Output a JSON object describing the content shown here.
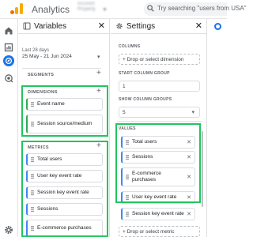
{
  "app": {
    "title": "Analytics",
    "account_line1": "Account",
    "account_line2": "Property",
    "search_placeholder": "Try searching \"users from USA\"",
    "brand_colors": {
      "accent": "#1a73e8",
      "logo_orange": "#f9ab00",
      "logo_dark": "#e37400"
    }
  },
  "rail": {
    "icons": [
      "home-icon",
      "reports-icon",
      "explore-icon",
      "advertising-icon",
      "settings-icon"
    ],
    "active": "explore-icon"
  },
  "variables": {
    "title": "Variables",
    "date": {
      "label": "Last 28 days",
      "range": "25 May - 21 Jun 2024"
    },
    "segments_label": "SEGMENTS",
    "dimensions_label": "DIMENSIONS",
    "dimensions": [
      "Event name",
      "Session source/medium"
    ],
    "metrics_label": "METRICS",
    "metrics": [
      "Total users",
      "User key event rate",
      "Session key event rate",
      "Sessions",
      "E-commerce purchases"
    ]
  },
  "settings": {
    "title": "Settings",
    "columns_label": "COLUMNS",
    "columns_drop": "+ Drop or select dimension",
    "start_column_group_label": "START COLUMN GROUP",
    "start_column_group_value": "1",
    "show_column_groups_label": "SHOW COLUMN GROUPS",
    "show_column_groups_value": "5",
    "values_label": "VALUES",
    "values": [
      "Total users",
      "Sessions",
      "E-commerce purchases",
      "User key event rate",
      "Session key event rate"
    ],
    "values_drop": "+ Drop or select metric"
  },
  "highlight_color": "#22c55e"
}
